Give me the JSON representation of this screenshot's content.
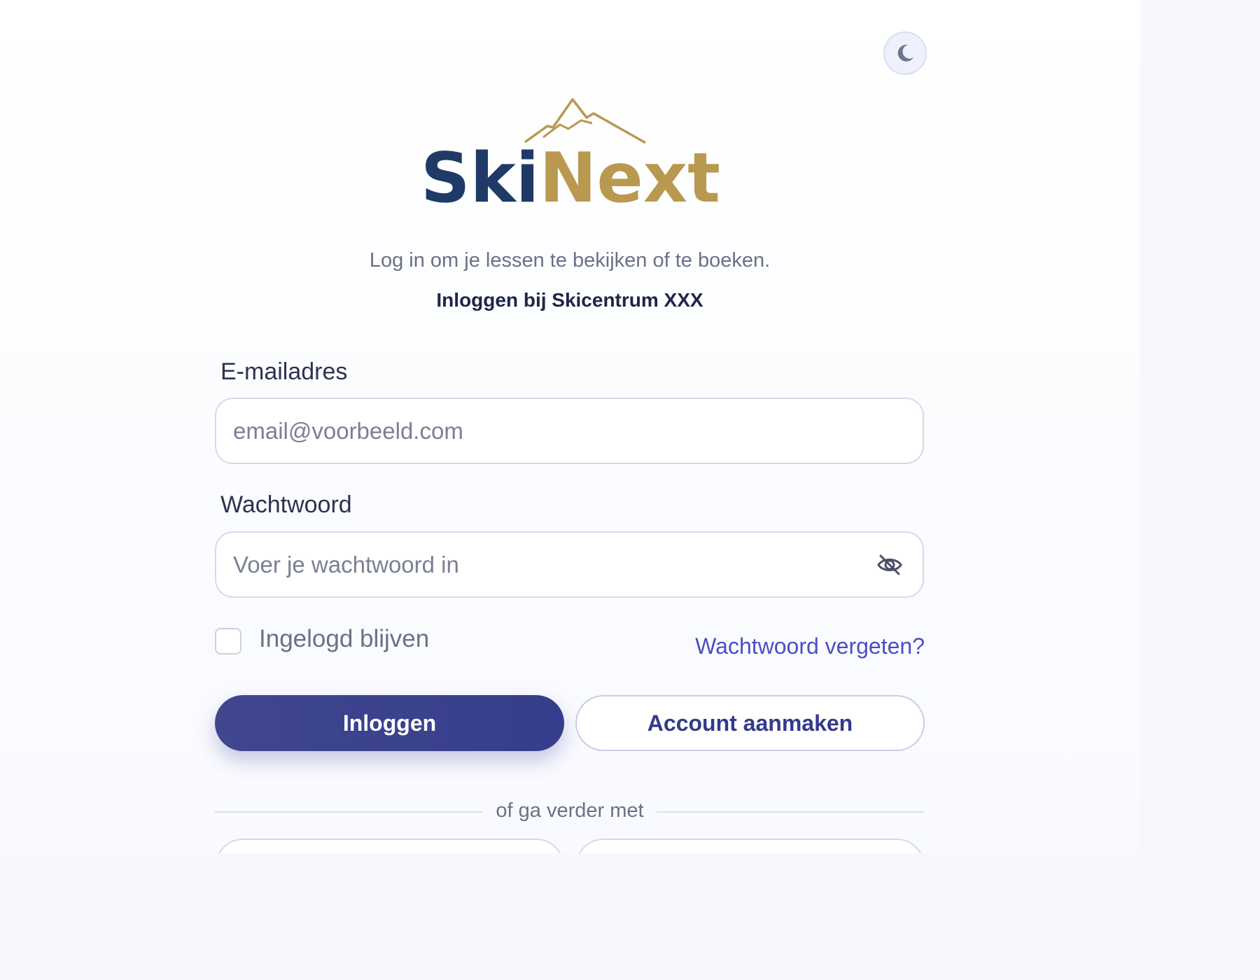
{
  "theme_toggle": {
    "icon": "moon-icon"
  },
  "logo": {
    "part1": "Ski",
    "part2": "Next",
    "navy": "#1f3a66",
    "gold": "#b8994f"
  },
  "header": {
    "subtitle": "Log in om je lessen te bekijken of te boeken.",
    "title": "Inloggen bij Skicentrum XXX"
  },
  "form": {
    "email_label": "E-mailadres",
    "email_placeholder": "email@voorbeeld.com",
    "password_label": "Wachtwoord",
    "password_placeholder": "Voer je wachtwoord in",
    "password_toggle_icon": "eye-off-icon",
    "remember_label": "Ingelogd blijven",
    "remember_checked": false,
    "forgot_label": "Wachtwoord vergeten?"
  },
  "actions": {
    "login_label": "Inloggen",
    "create_account_label": "Account aanmaken"
  },
  "divider": {
    "text": "of ga verder met"
  },
  "colors": {
    "primary": "#3b4190",
    "link": "#4a4fc4",
    "text_dark": "#1e2548",
    "text_muted": "#6b7088"
  }
}
